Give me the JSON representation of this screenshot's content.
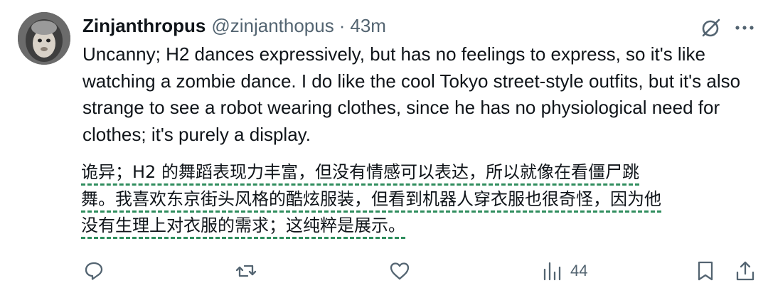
{
  "author": {
    "display_name": "Zinjanthropus",
    "handle": "@zinjanthopus",
    "separator": "·",
    "time": "43m"
  },
  "post": {
    "text": "Uncanny; H2 dances expressively, but has no feelings to express, so it's like watching a zombie dance. I do like the cool Tokyo street-style outfits, but it's also strange to see a robot wearing clothes, since he has no physiological need for clothes; it's purely a display.",
    "translation_lines": [
      "诡异；H2 的舞蹈表现力丰富，但没有情感可以表达，所以就像在看僵尸跳",
      "舞。我喜欢东京街头风格的酷炫服装，但看到机器人穿衣服也很奇怪，因为他",
      "没有生理上对衣服的需求；这纯粹是展示。"
    ]
  },
  "icons": {
    "grok": "grok-icon",
    "more": "more-icon",
    "reply": "reply-icon",
    "repost": "repost-icon",
    "like": "like-icon",
    "views": "views-icon",
    "bookmark": "bookmark-icon",
    "share": "share-icon"
  },
  "metrics": {
    "views": "44"
  },
  "colors": {
    "text": "#0f1419",
    "secondary": "#536471",
    "translation_underline": "#2f8d5d"
  }
}
